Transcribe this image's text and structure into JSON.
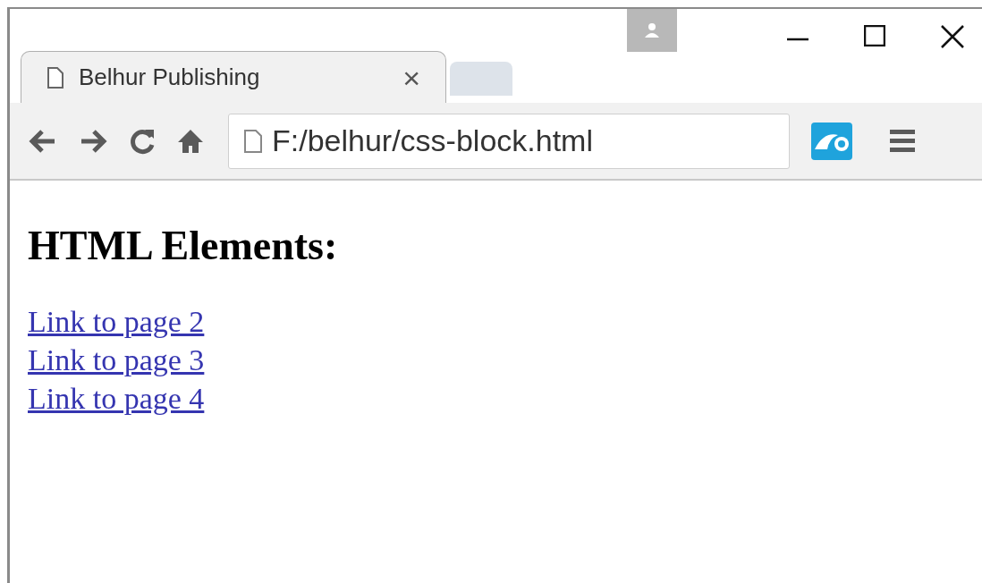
{
  "window": {
    "controls": [
      {
        "kind": "minimize"
      },
      {
        "kind": "maximize"
      },
      {
        "kind": "close"
      }
    ]
  },
  "tabs": [
    {
      "title": "Belhur Publishing",
      "selected": true,
      "close": "×"
    }
  ],
  "toolbar": {
    "address": "F:/belhur/css-block.html"
  },
  "page": {
    "heading": "HTML Elements:",
    "links": [
      "Link to page 2",
      "Link to page 3",
      "Link to page 4"
    ]
  }
}
